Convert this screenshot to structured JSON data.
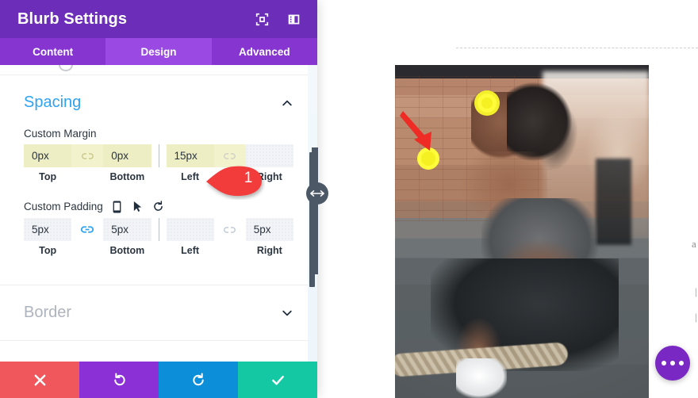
{
  "panel": {
    "title": "Blurb Settings",
    "header_icons": [
      {
        "name": "focus-frame-icon",
        "glyph": "focus"
      },
      {
        "name": "layout-columns-icon",
        "glyph": "layout"
      }
    ],
    "tabs": [
      {
        "label": "Content",
        "active": false
      },
      {
        "label": "Design",
        "active": true
      },
      {
        "label": "Advanced",
        "active": false
      }
    ],
    "sections": [
      {
        "title": "Spacing",
        "open": true,
        "chevron": "chevron-up"
      },
      {
        "title": "Border",
        "open": false,
        "chevron": "chevron-down"
      }
    ],
    "margin": {
      "label": "Custom Margin",
      "fields": [
        {
          "label": "Top",
          "value": "0px",
          "highlighted": true
        },
        {
          "label": "Bottom",
          "value": "0px",
          "highlighted": true
        },
        {
          "label": "Left",
          "value": "15px",
          "highlighted": true
        },
        {
          "label": "Right",
          "value": "",
          "highlighted": false
        }
      ],
      "link_left_state": "unlinked",
      "link_right_state": "none"
    },
    "padding": {
      "label": "Custom Padding",
      "icons": [
        {
          "name": "mobile-device-icon"
        },
        {
          "name": "hover-cursor-icon"
        },
        {
          "name": "reset-icon"
        }
      ],
      "fields": [
        {
          "label": "Top",
          "value": "5px",
          "highlighted": false
        },
        {
          "label": "Bottom",
          "value": "5px",
          "highlighted": false
        },
        {
          "label": "Left",
          "value": "",
          "highlighted": false
        },
        {
          "label": "Right",
          "value": "5px",
          "highlighted": false
        }
      ],
      "link_left_state": "linked",
      "link_right_state": "unlinked"
    },
    "footer_buttons": [
      {
        "name": "cancel-button",
        "icon": "x",
        "color": "#f0575c"
      },
      {
        "name": "undo-button",
        "icon": "undo",
        "color": "#8b2fd6"
      },
      {
        "name": "redo-button",
        "icon": "redo",
        "color": "#0c8ed9"
      },
      {
        "name": "save-button",
        "icon": "check",
        "color": "#13c8a3"
      }
    ]
  },
  "callout": {
    "number": "1",
    "color": "#f23b3b"
  },
  "canvas": {
    "fab": {
      "name": "options-fab",
      "icon": "ellipsis",
      "color": "#7a28c4"
    },
    "photo_alt": "woman squatting with kettlebell in gym",
    "edge_text_1": "a",
    "edge_text_2": "|",
    "edge_text_3": "|"
  },
  "colors": {
    "header_purple": "#6c2eb9",
    "tab_purple": "#8635d1",
    "tab_active_purple": "#9a4ae2",
    "section_blue": "#2ea3f2",
    "highlight_yellow": "#eeeec4",
    "callout_red": "#f23b3b",
    "highlight_ring_yellow": "#f3ef2a"
  }
}
